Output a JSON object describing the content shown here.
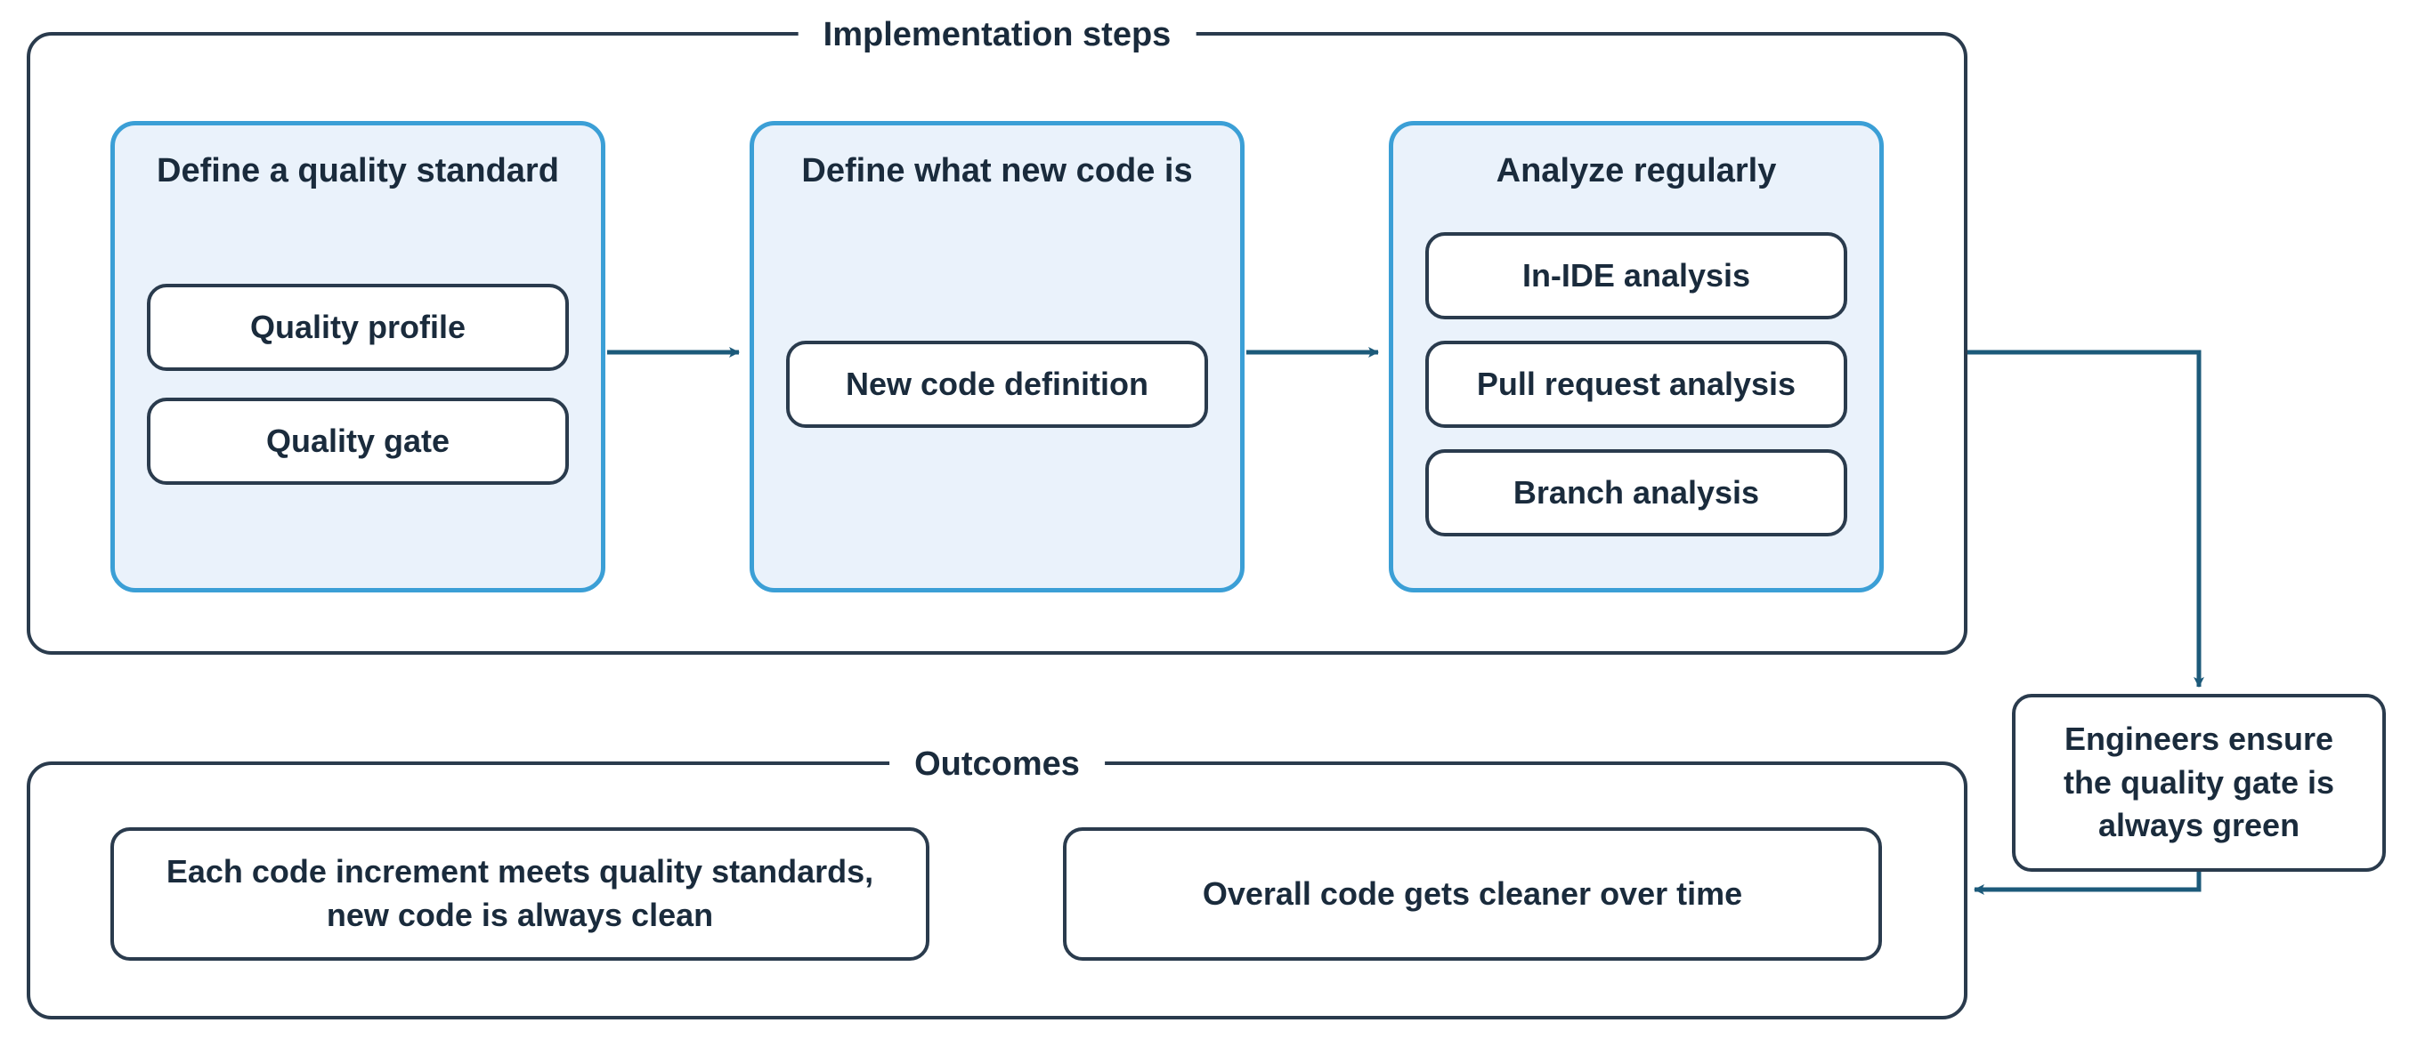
{
  "diagram": {
    "implementation": {
      "title": "Implementation steps",
      "steps": [
        {
          "title": "Define a quality standard",
          "items": [
            "Quality profile",
            "Quality gate"
          ]
        },
        {
          "title": "Define what new code is",
          "items": [
            "New code definition"
          ]
        },
        {
          "title": "Analyze regularly",
          "items": [
            "In-IDE analysis",
            "Pull request analysis",
            "Branch analysis"
          ]
        }
      ]
    },
    "engineers_node": "Engineers ensure the quality gate is always green",
    "outcomes": {
      "title": "Outcomes",
      "items": [
        "Each code increment meets quality standards, new code is always clean",
        "Overall code gets cleaner over time"
      ]
    }
  }
}
